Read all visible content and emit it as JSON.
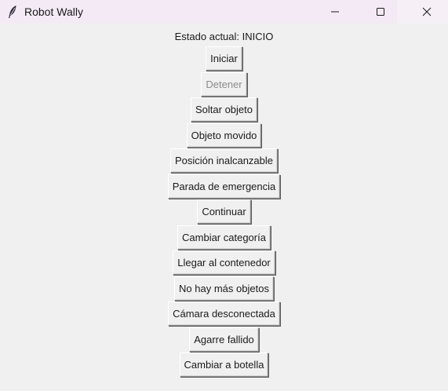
{
  "window": {
    "title": "Robot Wally",
    "icon": "feather-icon",
    "controls": [
      "minimize-icon",
      "maximize-icon",
      "close-icon"
    ]
  },
  "status": {
    "text": "Estado actual: INICIO"
  },
  "buttons": [
    {
      "label": "Iniciar",
      "enabled": true
    },
    {
      "label": "Detener",
      "enabled": false
    },
    {
      "label": "Soltar objeto",
      "enabled": true
    },
    {
      "label": "Objeto movido",
      "enabled": true
    },
    {
      "label": "Posición inalcanzable",
      "enabled": true
    },
    {
      "label": "Parada de emergencia",
      "enabled": true
    },
    {
      "label": "Continuar",
      "enabled": true
    },
    {
      "label": "Cambiar categoría",
      "enabled": true
    },
    {
      "label": "Llegar al contenedor",
      "enabled": true
    },
    {
      "label": "No hay más objetos",
      "enabled": true
    },
    {
      "label": "Cámara desconectada",
      "enabled": true
    },
    {
      "label": "Agarre fallido",
      "enabled": true
    },
    {
      "label": "Cambiar a botella",
      "enabled": true
    }
  ],
  "colors": {
    "titlebar": "#f4eaf6",
    "background": "#f0f0f0",
    "disabled_text": "#8c8c8c"
  }
}
